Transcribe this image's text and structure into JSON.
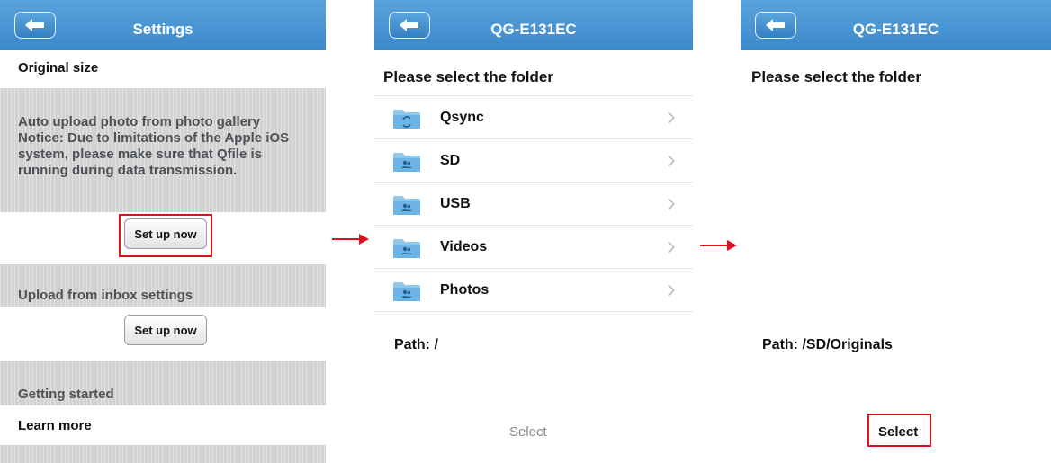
{
  "screen1": {
    "title": "Settings",
    "original_size": "Original size",
    "auto_upload_text": "Auto upload photo from photo gallery\nNotice: Due to limitations of the Apple iOS system, please make sure that Qfile is running during data transmission.",
    "setup_now_label_1": "Set up now",
    "upload_inbox_heading": "Upload from inbox settings",
    "setup_now_label_2": "Set up now",
    "getting_started": "Getting started",
    "learn_more": "Learn more"
  },
  "screen2": {
    "title": "QG-E131EC",
    "heading": "Please select the folder",
    "folders": [
      {
        "name": "Qsync",
        "icon": "qsync-folder-icon"
      },
      {
        "name": "SD",
        "icon": "shared-folder-icon"
      },
      {
        "name": "USB",
        "icon": "shared-folder-icon"
      },
      {
        "name": "Videos",
        "icon": "shared-folder-icon"
      },
      {
        "name": "Photos",
        "icon": "shared-folder-icon"
      }
    ],
    "path": "Path: /",
    "select_label": "Select"
  },
  "screen3": {
    "title": "QG-E131EC",
    "heading": "Please select the folder",
    "path": "Path: /SD/Originals",
    "select_label": "Select"
  },
  "colors": {
    "navbar": "#4a97d5",
    "highlight": "#d9101e",
    "section_gray": "#d2d2d2",
    "section_text": "#4e5257",
    "disabled_text": "#8a8a8a"
  }
}
